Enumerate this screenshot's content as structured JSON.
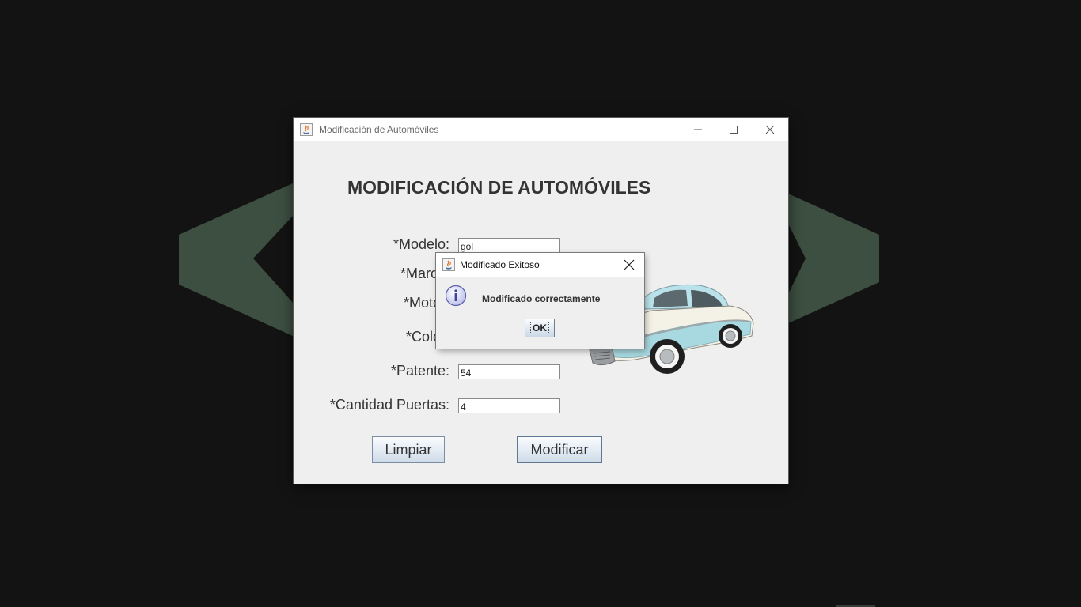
{
  "main_window": {
    "title": "Modificación de Automóviles",
    "heading": "MODIFICACIÓN DE AUTOMÓVILES",
    "fields": [
      {
        "label": "*Modelo:",
        "value": "gol"
      },
      {
        "label": "*Marca:",
        "value": ""
      },
      {
        "label": "*Motor:",
        "value": ""
      },
      {
        "label": "*Color:",
        "value": ""
      },
      {
        "label": "*Patente:",
        "value": "54"
      },
      {
        "label": "*Cantidad Puertas:",
        "value": "4"
      }
    ],
    "buttons": {
      "clear_label": "Limpiar",
      "modify_label": "Modificar"
    }
  },
  "dialog": {
    "title": "Modificado Exitoso",
    "message": "Modificado correctamente",
    "ok_label": "OK"
  },
  "icons": {
    "app": "java-icon",
    "minimize": "minimize-icon",
    "maximize": "maximize-icon",
    "close": "close-icon",
    "info": "info-icon"
  },
  "colors": {
    "desktop_bg": "#131313",
    "chevron": "#3c4f40",
    "window_bg": "#efefef",
    "car_body": "#a8d8e0"
  }
}
